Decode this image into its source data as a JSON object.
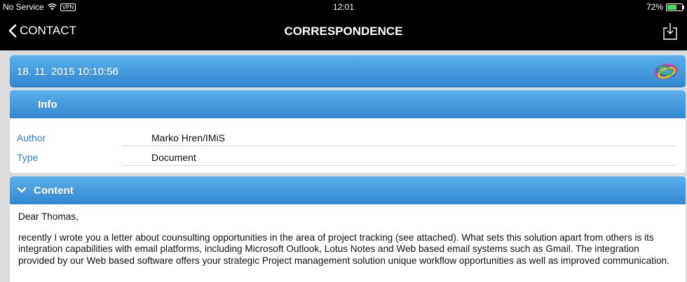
{
  "status_bar": {
    "carrier": "No Service",
    "vpn": "VPN",
    "time": "12:01",
    "battery": "72%",
    "battery_level": 0.72,
    "battery_color": "#4cd964"
  },
  "nav": {
    "back_label": "CONTACT",
    "title": "CORRESPONDENCE",
    "action_icon": "share-download-icon"
  },
  "header": {
    "datetime": "18. 11. 2015 10:10:56",
    "logo_icon": "swirl-logo"
  },
  "info": {
    "section_title": "Info",
    "rows": [
      {
        "key": "Author",
        "value": "Marko Hren/IMiS"
      },
      {
        "key": "Type",
        "value": "Document"
      }
    ]
  },
  "content": {
    "section_title": "Content",
    "greeting": "Dear Thomas,",
    "body": "recently I wrote you a letter about counsulting opportunities in the area of project tracking (see attached). What sets this solution apart from others is its integration capabilities with email platforms, including Microsoft Outlook, Lotus Notes and Web based email systems such as Gmail. The integration provided by our Web based software offers your strategic Project management solution unique workflow opportunities as well as improved communication."
  },
  "colors": {
    "accent_blue": "#3187cf",
    "label_blue": "#2f7fcf",
    "background": "#dcdcdc"
  }
}
